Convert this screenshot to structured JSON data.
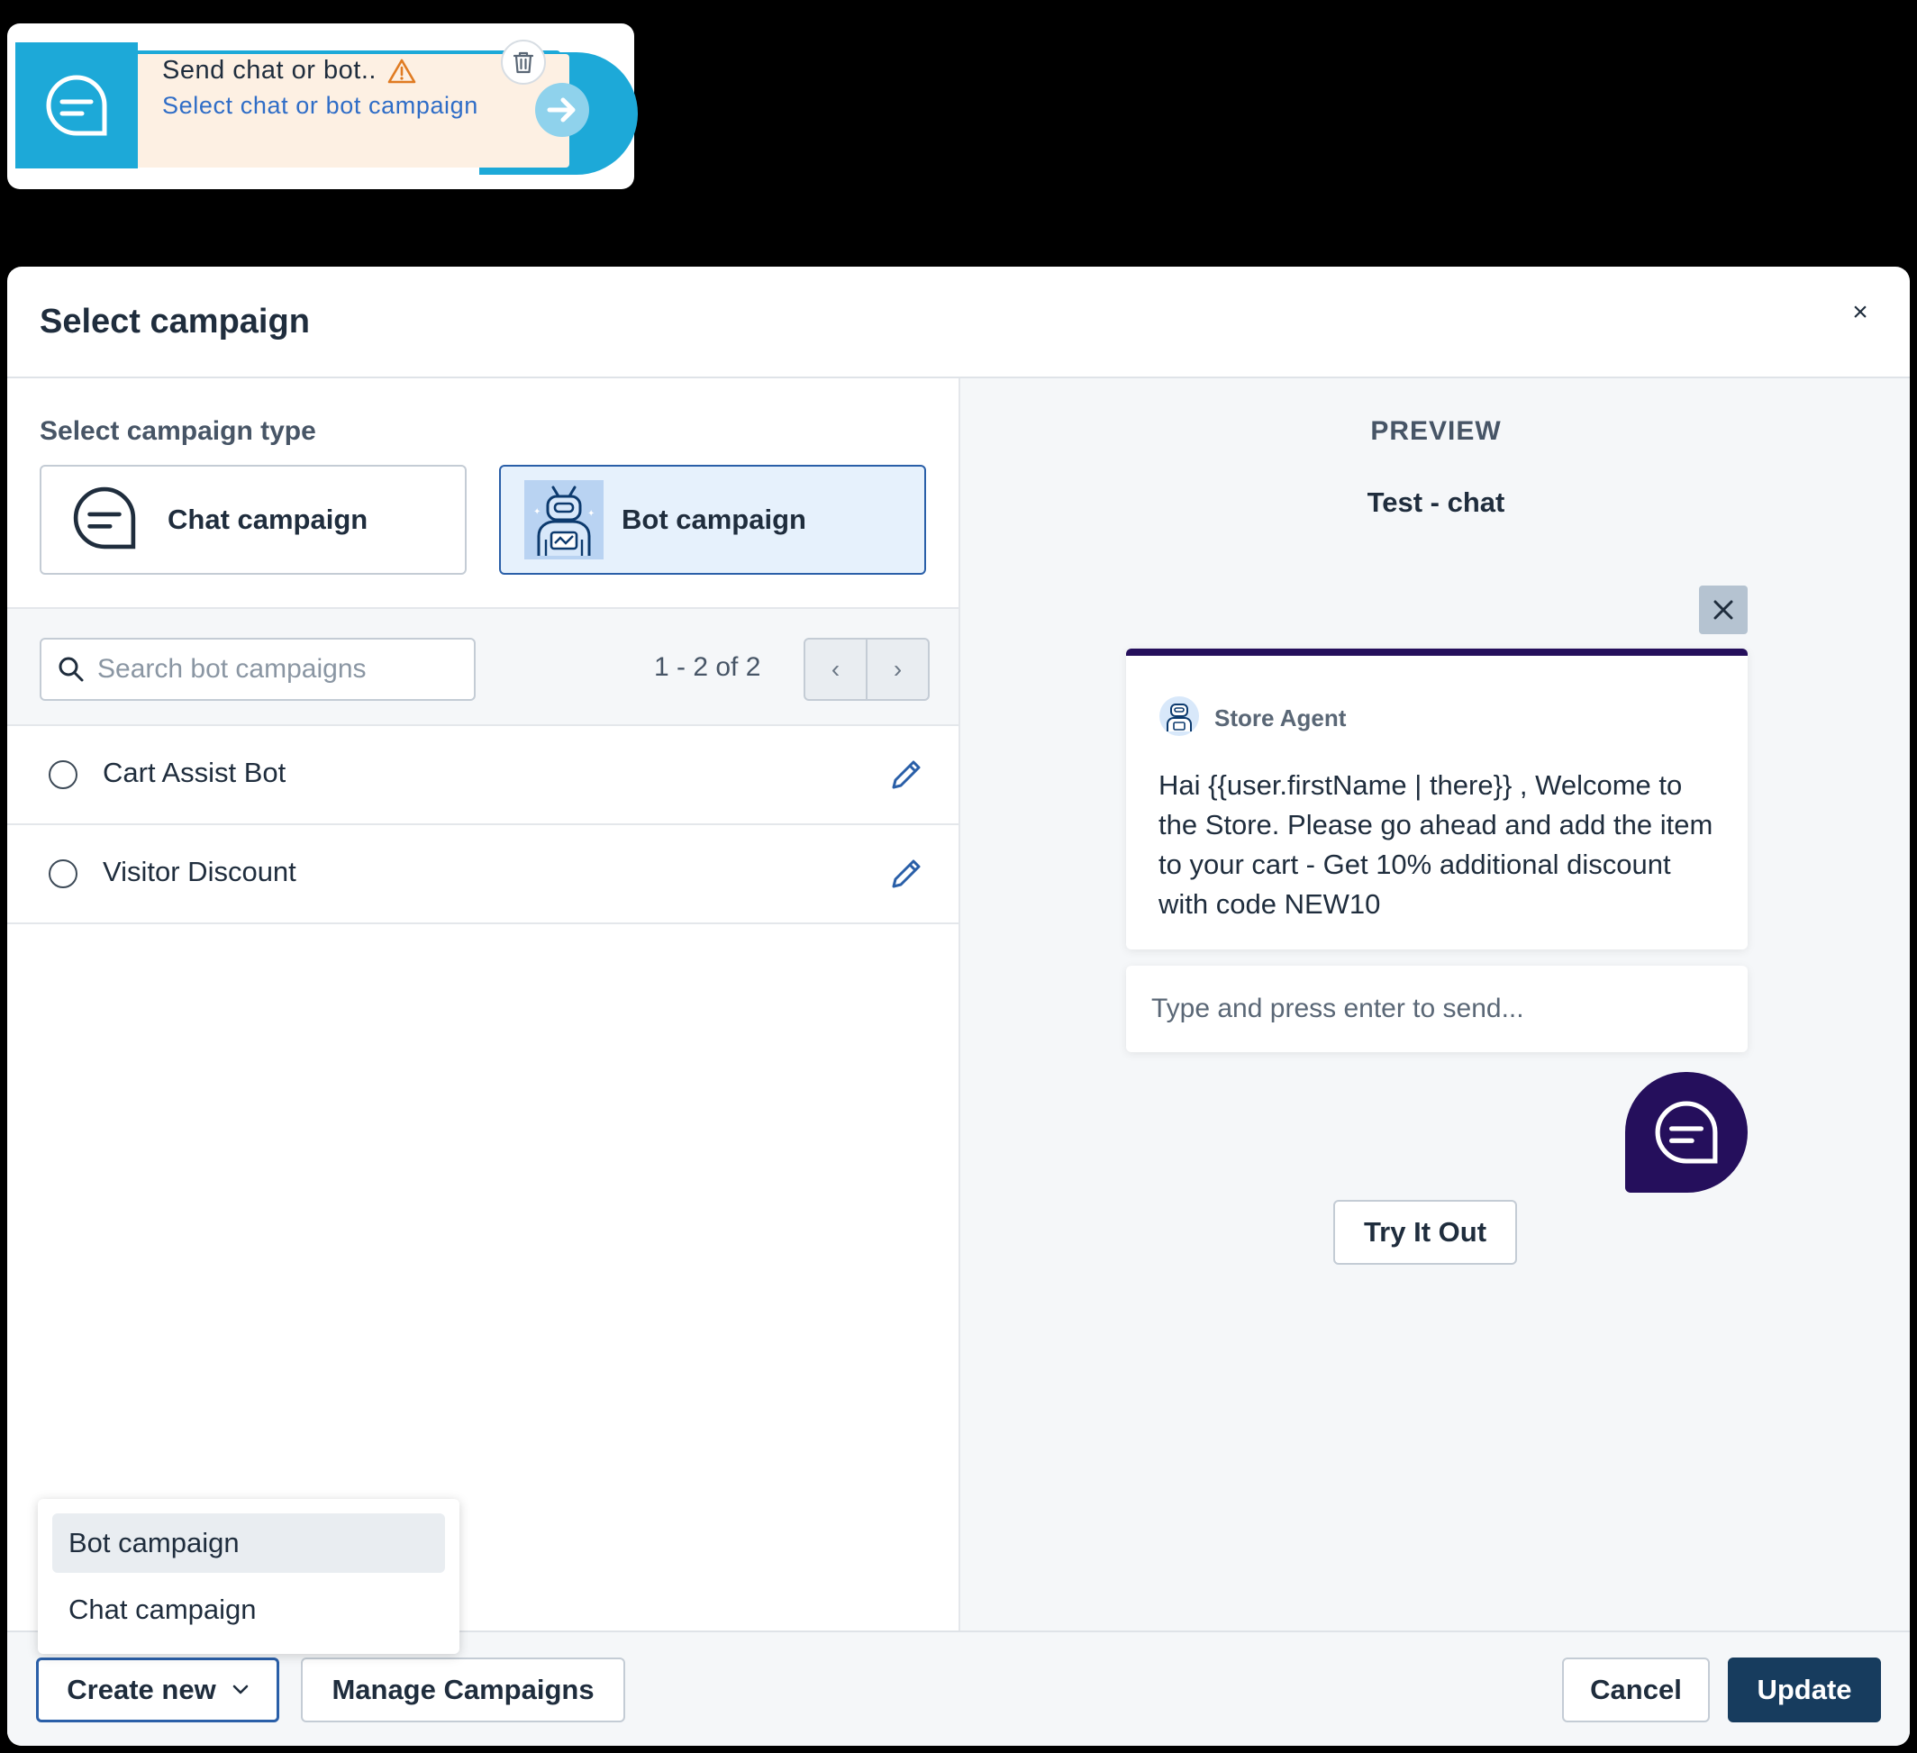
{
  "node": {
    "title": "Send chat or bot..",
    "subtitle": "Select chat or bot campaign",
    "colors": {
      "accent": "#1da9d8",
      "body": "#fdf0e3",
      "warning": "#e07b22",
      "subtitle": "#2f6dc7"
    },
    "icons": [
      "trash-icon",
      "chat-bubble-icon",
      "warning-icon",
      "arrow-right-icon"
    ]
  },
  "modal": {
    "title": "Select campaign",
    "close_label": "×"
  },
  "campaign_type": {
    "label": "Select campaign type",
    "options": [
      {
        "label": "Chat campaign",
        "icon": "chat-bubble-icon",
        "selected": false
      },
      {
        "label": "Bot campaign",
        "icon": "robot-icon",
        "selected": true
      }
    ]
  },
  "search": {
    "placeholder": "Search bot campaigns",
    "value": ""
  },
  "pager": {
    "text": "1 - 2 of 2",
    "prev": "‹",
    "next": "›"
  },
  "campaigns": [
    {
      "name": "Cart Assist Bot"
    },
    {
      "name": "Visitor Discount"
    }
  ],
  "create_menu": {
    "items": [
      {
        "label": "Bot campaign",
        "highlighted": true
      },
      {
        "label": "Chat campaign",
        "highlighted": false
      }
    ]
  },
  "preview": {
    "label": "PREVIEW",
    "name": "Test - chat",
    "agent_name": "Store Agent",
    "message": "Hai {{user.firstName | there}} , Welcome to the Store. Please go ahead and add the item to your cart - Get 10% additional discount with code NEW10",
    "input_placeholder": "Type and press enter to send...",
    "try_label": "Try It Out",
    "colors": {
      "chat_theme": "#250f5c"
    }
  },
  "footer": {
    "create_label": "Create new",
    "manage_label": "Manage Campaigns",
    "cancel_label": "Cancel",
    "update_label": "Update",
    "colors": {
      "primary": "#173c5e",
      "focus": "#2a5fa8"
    }
  }
}
